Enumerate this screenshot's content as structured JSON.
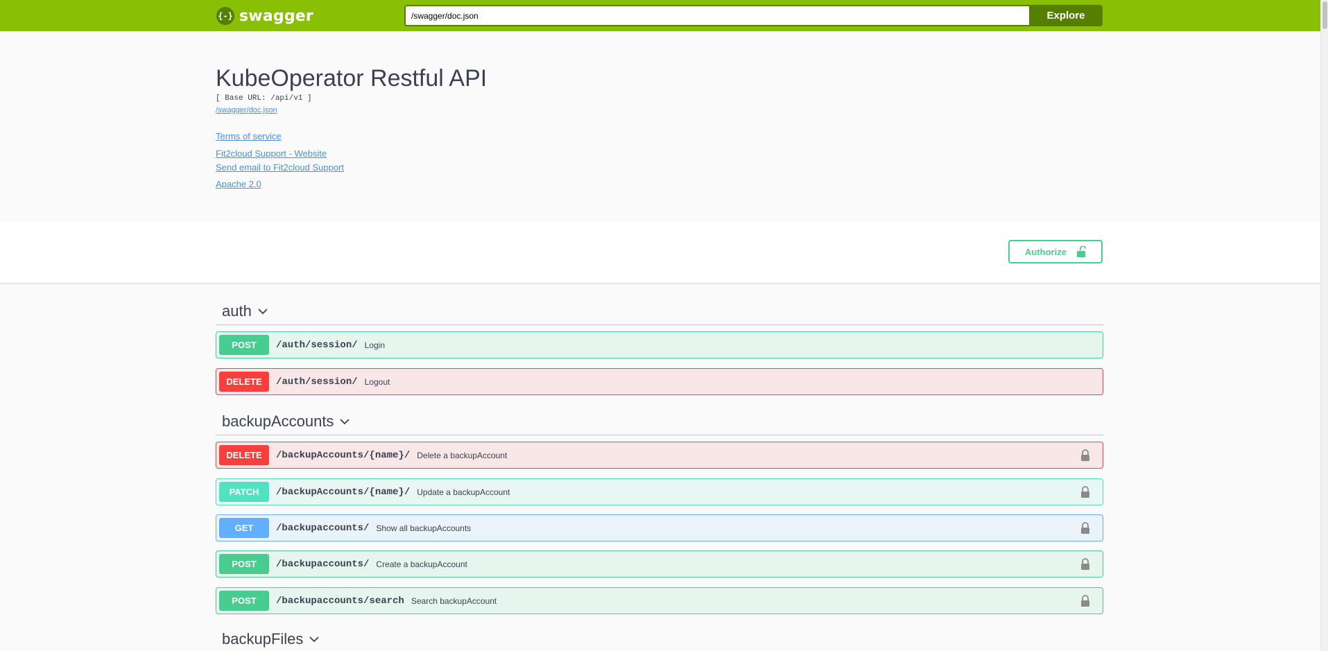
{
  "topbar": {
    "logo_mark": "{-}",
    "logo_text": "swagger",
    "url_value": "/swagger/doc.json",
    "explore_label": "Explore"
  },
  "info": {
    "title": "KubeOperator Restful API",
    "base_url": "[ Base URL: /api/v1 ]",
    "spec_link": "/swagger/doc.json",
    "terms": "Terms of service",
    "support_website": "Fit2cloud Support - Website",
    "support_email": "Send email to Fit2cloud Support",
    "license": "Apache 2.0"
  },
  "authorize": {
    "label": "Authorize",
    "icon": "unlock-icon"
  },
  "tags": [
    {
      "name": "auth",
      "operations": [
        {
          "method": "POST",
          "path": "/auth/session/",
          "summary": "Login",
          "locked": false
        },
        {
          "method": "DELETE",
          "path": "/auth/session/",
          "summary": "Logout",
          "locked": false
        }
      ]
    },
    {
      "name": "backupAccounts",
      "operations": [
        {
          "method": "DELETE",
          "path": "/backupAccounts/{name}/",
          "summary": "Delete a backupAccount",
          "locked": true
        },
        {
          "method": "PATCH",
          "path": "/backupAccounts/{name}/",
          "summary": "Update a backupAccount",
          "locked": true
        },
        {
          "method": "GET",
          "path": "/backupaccounts/",
          "summary": "Show all backupAccounts",
          "locked": true
        },
        {
          "method": "POST",
          "path": "/backupaccounts/",
          "summary": "Create a backupAccount",
          "locked": true
        },
        {
          "method": "POST",
          "path": "/backupaccounts/search",
          "summary": "Search backupAccount",
          "locked": true
        }
      ]
    },
    {
      "name": "backupFiles",
      "operations": []
    }
  ],
  "colors": {
    "topbar": "#89bf04",
    "topbar_dark": "#547f00",
    "post": "#49cc90",
    "delete": "#f93e3e",
    "patch": "#50e3c2",
    "get": "#61affe",
    "link": "#4990e2",
    "text": "#3b4151"
  }
}
